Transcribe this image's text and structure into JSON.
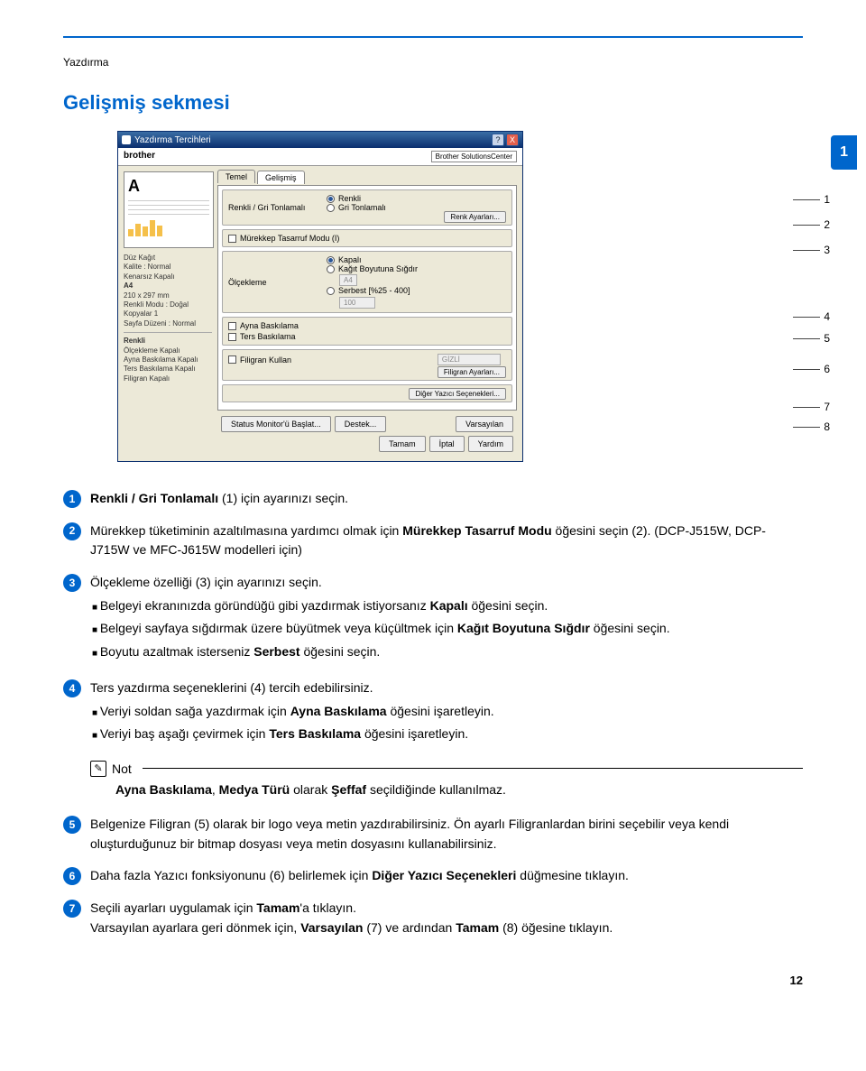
{
  "chapter": "Yazdırma",
  "section_title": "Gelişmiş sekmesi",
  "side_badge": "1",
  "dialog": {
    "title": "Yazdırma Tercihleri",
    "help_q": "?",
    "close_x": "X",
    "brand": "brother",
    "solutions": "Brother SolutionsCenter",
    "tabs": {
      "basic": "Temel",
      "advanced": "Gelişmiş"
    },
    "preview_A": "A",
    "summary": {
      "l1": "Düz Kağıt",
      "l2": "Kalite : Normal",
      "l3": "Kenarsız Kapalı",
      "l4": "A4",
      "l5": "210 x 297 mm",
      "l6": "Renkli Modu : Doğal",
      "l7": "Kopyalar 1",
      "l8": "Sayfa Düzeni : Normal",
      "l9": "Renkli",
      "l10": "Ölçekleme Kapalı",
      "l11": "Ayna Baskılama Kapalı",
      "l12": "Ters Baskılama Kapalı",
      "l13": "Filigran Kapalı"
    },
    "g1": {
      "label": "Renkli / Gri Tonlamalı",
      "opt1": "Renkli",
      "opt2": "Gri Tonlamalı",
      "btn": "Renk Ayarları..."
    },
    "g2": {
      "label": "Mürekkep Tasarruf Modu (I)"
    },
    "g3": {
      "label": "Ölçekleme",
      "opt1": "Kapalı",
      "opt2": "Kağıt Boyutuna Sığdır",
      "sel": "A4",
      "opt3": "Serbest [%25 - 400]",
      "spin": "100"
    },
    "g4": {
      "chk1": "Ayna Baskılama",
      "chk2": "Ters Baskılama"
    },
    "g5": {
      "chk": "Filigran Kullan",
      "sel": "GİZLİ",
      "btn": "Filigran Ayarları..."
    },
    "g6": {
      "btn": "Diğer Yazıcı Seçenekleri..."
    },
    "bottom": {
      "status": "Status Monitor'ü Başlat...",
      "support": "Destek...",
      "default": "Varsayılan",
      "ok": "Tamam",
      "cancel": "İptal",
      "help": "Yardım"
    }
  },
  "callouts": {
    "c1": "1",
    "c2": "2",
    "c3": "3",
    "c4": "4",
    "c5": "5",
    "c6": "6",
    "c7": "7",
    "c8": "8"
  },
  "items": {
    "n1": {
      "num": "1",
      "text_a": "Renkli / Gri Tonlamalı",
      "text_b": " (1) için ayarınızı seçin."
    },
    "n2": {
      "num": "2",
      "text_a": "Mürekkep tüketiminin azaltılmasına yardımcı olmak için ",
      "term": "Mürekkep Tasarruf Modu",
      "text_b": " öğesini seçin (2). (DCP-J515W, DCP-J715W ve MFC-J615W modelleri için)"
    },
    "n3": {
      "num": "3",
      "lead": "Ölçekleme özelliği (3) için ayarınızı seçin.",
      "s1_a": "Belgeyi ekranınızda göründüğü gibi yazdırmak istiyorsanız ",
      "s1_term": "Kapalı",
      "s1_b": " öğesini seçin.",
      "s2_a": "Belgeyi sayfaya sığdırmak üzere büyütmek veya küçültmek için ",
      "s2_term": "Kağıt Boyutuna Sığdır",
      "s2_b": " öğesini seçin.",
      "s3_a": "Boyutu azaltmak isterseniz ",
      "s3_term": "Serbest",
      "s3_b": " öğesini seçin."
    },
    "n4": {
      "num": "4",
      "lead": "Ters yazdırma seçeneklerini (4) tercih edebilirsiniz.",
      "s1_a": "Veriyi soldan sağa yazdırmak için ",
      "s1_term": "Ayna Baskılama",
      "s1_b": " öğesini işaretleyin.",
      "s2_a": "Veriyi baş aşağı çevirmek için ",
      "s2_term": "Ters Baskılama",
      "s2_b": " öğesini işaretleyin."
    },
    "n5": {
      "num": "5",
      "text": "Belgenize Filigran (5) olarak bir logo veya metin yazdırabilirsiniz. Ön ayarlı Filigranlardan birini seçebilir veya kendi oluşturduğunuz bir bitmap dosyası veya metin dosyasını kullanabilirsiniz."
    },
    "n6": {
      "num": "6",
      "text_a": "Daha fazla Yazıcı fonksiyonunu (6) belirlemek için ",
      "term": "Diğer Yazıcı Seçenekleri",
      "text_b": " düğmesine tıklayın."
    },
    "n7": {
      "num": "7",
      "l1_a": "Seçili ayarları uygulamak için ",
      "l1_term": "Tamam",
      "l1_b": "'a tıklayın.",
      "l2_a": "Varsayılan ayarlara geri dönmek için, ",
      "l2_term1": "Varsayılan",
      "l2_mid": " (7) ve ardından ",
      "l2_term2": "Tamam",
      "l2_b": " (8) öğesine tıklayın."
    }
  },
  "note": {
    "label": "Not",
    "body_a": "Ayna Baskılama",
    "body_mid": ", ",
    "body_b": "Medya Türü",
    "body_c": " olarak ",
    "body_d": "Şeffaf",
    "body_e": " seçildiğinde kullanılmaz."
  },
  "page_number": "12"
}
